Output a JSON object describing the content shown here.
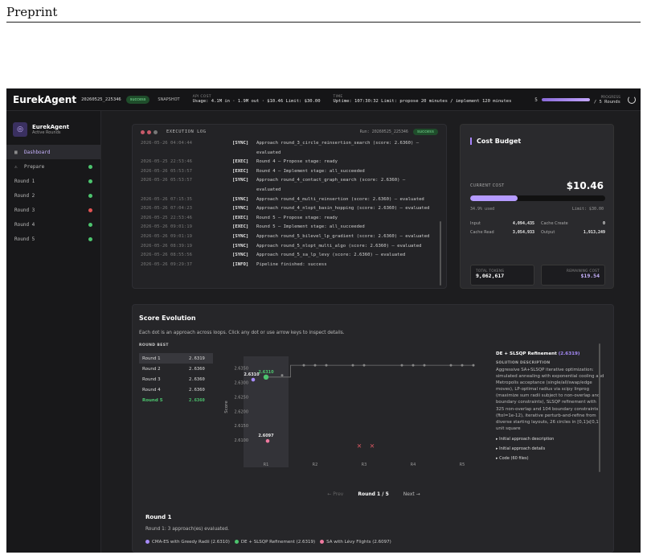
{
  "page": {
    "header": "Preprint"
  },
  "topbar": {
    "brand": "EurekAgent",
    "run_id": "20260525_225346",
    "status": "success",
    "snapshot": "SNAPSHOT",
    "api_cost_label": "API COST",
    "api_cost_value": "Usage: 4.1M in · 1.9M out · $10.46  Limit: $30.00",
    "time_label": "TIME",
    "time_value": "Uptime: 107:30:32  Limit: propose 20 minutes / implement 120 minutes",
    "progress_current": "5",
    "progress_label": "PROGRESS",
    "progress_value": "/ 5 Rounds",
    "progress_fraction": 1.0
  },
  "sidebar": {
    "title": "EurekAgent",
    "subtitle": "Active Rounds",
    "items": [
      {
        "label": "Dashboard",
        "icon": "grid-icon",
        "status": ""
      },
      {
        "label": "Prepare",
        "icon": "warning-icon",
        "status": "ok"
      },
      {
        "label": "Round 1",
        "status": "ok"
      },
      {
        "label": "Round 2",
        "status": "ok"
      },
      {
        "label": "Round 3",
        "status": "fail"
      },
      {
        "label": "Round 4",
        "status": "ok"
      },
      {
        "label": "Round 5",
        "status": "ok"
      }
    ]
  },
  "log": {
    "title": "EXECUTION LOG",
    "run": "Run: 20260525_225346",
    "status": "success",
    "lines": [
      {
        "ts": "2026-05-26 04:04:44",
        "tag": "[SYNC]",
        "msg": "Approach round_3_circle_reinsertion_search (score: 2.6360) —",
        "cont": "evaluated"
      },
      {
        "ts": "2026-05-25 22:53:46",
        "tag": "[EXEC]",
        "msg": "Round 4 — Propose stage: ready"
      },
      {
        "ts": "2026-05-26 05:53:57",
        "tag": "[EXEC]",
        "msg": "Round 4 — Implement stage: all_succeeded"
      },
      {
        "ts": "2026-05-26 05:53:57",
        "tag": "[SYNC]",
        "msg": "Approach round_4_contact_graph_search (score: 2.6360) —",
        "cont": "evaluated"
      },
      {
        "ts": "2026-05-26 07:15:35",
        "tag": "[SYNC]",
        "msg": "Approach round_4_multi_reinsertion (score: 2.6360) — evaluated"
      },
      {
        "ts": "2026-05-26 07:04:23",
        "tag": "[SYNC]",
        "msg": "Approach round_4_nlopt_basin_hopping (score: 2.6360) — evaluated"
      },
      {
        "ts": "2026-05-25 22:53:46",
        "tag": "[EXEC]",
        "msg": "Round 5 — Propose stage: ready"
      },
      {
        "ts": "2026-05-26 09:01:19",
        "tag": "[EXEC]",
        "msg": "Round 5 — Implement stage: all_succeeded"
      },
      {
        "ts": "2026-05-26 09:01:19",
        "tag": "[SYNC]",
        "msg": "Approach round_5_bilevel_lp_gradient (score: 2.6360) — evaluated"
      },
      {
        "ts": "2026-05-26 08:39:19",
        "tag": "[SYNC]",
        "msg": "Approach round_5_nlopt_multi_algo (score: 2.6360) — evaluated"
      },
      {
        "ts": "2026-05-26 08:55:56",
        "tag": "[SYNC]",
        "msg": "Approach round_5_sa_lp_levy (score: 2.6360) — evaluated"
      },
      {
        "ts": "2026-05-26 09:29:37",
        "tag": "[INFO]",
        "msg": "Pipeline finished: success"
      }
    ]
  },
  "cost": {
    "title": "Cost Budget",
    "current_label": "CURRENT COST",
    "current_value": "$10.46",
    "used_fraction": 0.349,
    "used_text": "34.9% used",
    "limit_text": "Limit: $30.00",
    "rows": [
      {
        "k1": "Input",
        "v1": "4,094,435",
        "k2": "Cache Create",
        "v2": "0"
      },
      {
        "k1": "Cache Read",
        "v1": "3,054,933",
        "k2": "Output",
        "v2": "1,913,249"
      }
    ],
    "total_tokens_label": "TOTAL TOKENS",
    "total_tokens": "9,062,617",
    "remaining_label": "REMAINING COST",
    "remaining": "$19.54"
  },
  "score": {
    "title": "Score Evolution",
    "description": "Each dot is an approach across loops. Click any dot or use arrow keys to inspect details.",
    "round_best_label": "ROUND BEST",
    "rounds": [
      {
        "name": "Round 1",
        "score": "2.6319"
      },
      {
        "name": "Round 2",
        "score": "2.6360"
      },
      {
        "name": "Round 3",
        "score": "2.6360"
      },
      {
        "name": "Round 4",
        "score": "2.6360"
      },
      {
        "name": "Round 5",
        "score": "2.6360"
      }
    ],
    "detail": {
      "title": "DE + SLSQP Refinement",
      "score": "(2.6319)",
      "section": "SOLUTION DESCRIPTION",
      "body": "Aggressive SA+SLSQP iterative optimization: simulated annealing with exponential cooling and Metropolis acceptance (single/all/swap/edge moves), LP-optimal radius via scipy linprog (maximize sum radii subject to non-overlap and boundary constraints), SLSQP refinement with 325 non-overlap and 104 boundary constraints (ftol=1e-12), iterative perturb-and-refine from diverse starting layouts, 26 circles in [0,1]x[0,1] unit square",
      "links": [
        "▸ Initial approach description",
        "▸ Initial approach details",
        "▸ Code (60 files)"
      ]
    },
    "pager": {
      "prev": "← Prev",
      "current": "Round 1 / 5",
      "next": "Next →"
    },
    "summary_title": "Round 1",
    "summary_text": "Round 1: 3 approach(es) evaluated.",
    "legend": [
      {
        "label": "CMA-ES with Greedy Radii (2.6310)",
        "color": "#a78bfa"
      },
      {
        "label": "DE + SLSQP Refinement (2.6319)",
        "color": "#4cc46e"
      },
      {
        "label": "SA with Lévy Flights (2.6097)",
        "color": "#f07aa0"
      }
    ]
  },
  "chart_data": {
    "type": "scatter",
    "xlabel": "",
    "ylabel": "Score",
    "categories": [
      "R1",
      "R2",
      "R3",
      "R4",
      "R5"
    ],
    "ylim": [
      2.605,
      2.638
    ],
    "yticks": [
      2.635,
      2.63,
      2.625,
      2.62,
      2.615,
      2.61
    ],
    "grid": false,
    "series": [
      {
        "name": "approaches",
        "points": [
          {
            "x": "R1",
            "y": 2.631,
            "color": "#a78bfa",
            "label": "2.6310"
          },
          {
            "x": "R1",
            "y": 2.6319,
            "color": "#4cc46e",
            "label": "2.6310",
            "highlight": true
          },
          {
            "x": "R1",
            "y": 2.6097,
            "color": "#f07aa0",
            "label": "2.6097"
          },
          {
            "x": "R1",
            "y": 2.6325,
            "color": "#888888"
          },
          {
            "x": "R2",
            "y": 2.636,
            "color": "#888888"
          },
          {
            "x": "R2",
            "y": 2.636,
            "color": "#888888"
          },
          {
            "x": "R2",
            "y": 2.636,
            "color": "#888888"
          },
          {
            "x": "R3",
            "y": 2.636,
            "color": "#888888"
          },
          {
            "x": "R3",
            "y": 2.636,
            "color": "#888888"
          },
          {
            "x": "R4",
            "y": 2.636,
            "color": "#888888"
          },
          {
            "x": "R4",
            "y": 2.636,
            "color": "#888888"
          },
          {
            "x": "R4",
            "y": 2.636,
            "color": "#888888"
          },
          {
            "x": "R5",
            "y": 2.636,
            "color": "#888888"
          },
          {
            "x": "R5",
            "y": 2.636,
            "color": "#888888"
          },
          {
            "x": "R5",
            "y": 2.636,
            "color": "#888888"
          }
        ]
      },
      {
        "name": "failed",
        "points": [
          {
            "x": "R3",
            "y": 2.608,
            "marker": "x",
            "color": "#c0505a"
          },
          {
            "x": "R3",
            "y": 2.608,
            "marker": "x",
            "color": "#c0505a"
          }
        ]
      }
    ],
    "best_line": [
      {
        "x": "R1",
        "y": 2.6319
      },
      {
        "x": "R2",
        "y": 2.636
      },
      {
        "x": "R3",
        "y": 2.636
      },
      {
        "x": "R4",
        "y": 2.636
      },
      {
        "x": "R5",
        "y": 2.636
      }
    ]
  }
}
